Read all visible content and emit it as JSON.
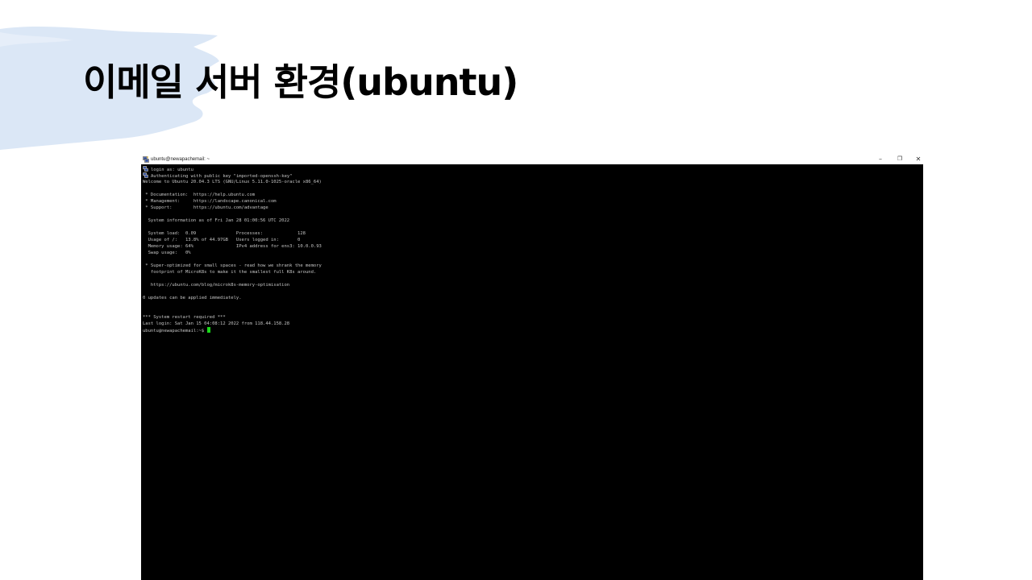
{
  "slide": {
    "title": "이메일 서버 환경(ubuntu)"
  },
  "window": {
    "title": "ubuntu@newapachemail: ~",
    "minimize": "–",
    "maximize": "❐",
    "close": "✕"
  },
  "terminal": {
    "lines": [
      "login as: ubuntu",
      "Authenticating with public key \"imported-openssh-key\"",
      "Welcome to Ubuntu 20.04.3 LTS (GNU/Linux 5.11.0-1025-oracle x86_64)",
      "",
      " * Documentation:  https://help.ubuntu.com",
      " * Management:     https://landscape.canonical.com",
      " * Support:        https://ubuntu.com/advantage",
      "",
      "  System information as of Fri Jan 28 01:00:56 UTC 2022",
      "",
      "  System load:  0.09               Processes:             128",
      "  Usage of /:   13.8% of 44.97GB   Users logged in:       0",
      "  Memory usage: 64%                IPv4 address for ens3: 10.0.0.93",
      "  Swap usage:   0%",
      "",
      " * Super-optimized for small spaces - read how we shrank the memory",
      "   footprint of MicroK8s to make it the smallest full K8s around.",
      "",
      "   https://ubuntu.com/blog/microk8s-memory-optimisation",
      "",
      "0 updates can be applied immediately.",
      "",
      "",
      "*** System restart required ***",
      "Last login: Sat Jan 15 04:08:12 2022 from 118.44.158.28",
      "ubuntu@newapachemail:~$ "
    ]
  },
  "colors": {
    "brush": "#dbe7f6",
    "terminal_bg": "#000000",
    "terminal_text": "#c4c4c4",
    "cursor": "#1ad81a"
  },
  "icons": {
    "window_icon": "putty-icon",
    "login_line_icon": "putty-icon"
  }
}
